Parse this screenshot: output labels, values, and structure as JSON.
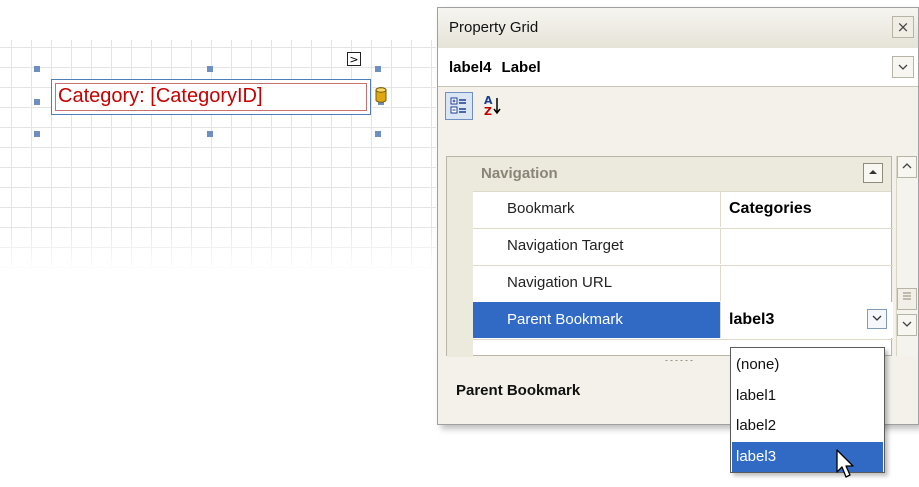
{
  "designer": {
    "label_text": "Category: [CategoryID]",
    "smart_tag_glyph": ">",
    "icon": "database-icon"
  },
  "property_grid": {
    "title": "Property Grid",
    "close_glyph": "×",
    "selected_object": {
      "name": "label4",
      "type": "Label"
    },
    "toolbar": {
      "categorized_icon": "categorized-icon",
      "alphabetical_icon": "sort-az-icon",
      "alphabetical_glyph_a": "A",
      "alphabetical_glyph_z": "Z"
    },
    "category": {
      "label": "Navigation"
    },
    "rows": [
      {
        "name": "Bookmark",
        "value": "Categories"
      },
      {
        "name": "Navigation Target",
        "value": ""
      },
      {
        "name": "Navigation URL",
        "value": ""
      },
      {
        "name": "Parent Bookmark",
        "value": "label3"
      }
    ],
    "description_title": "Parent Bookmark"
  },
  "dropdown": {
    "items": [
      "(none)",
      "label1",
      "label2",
      "label3"
    ],
    "selected": "label3"
  },
  "colors": {
    "selection": "#316ac5",
    "label_text": "#c80000"
  }
}
